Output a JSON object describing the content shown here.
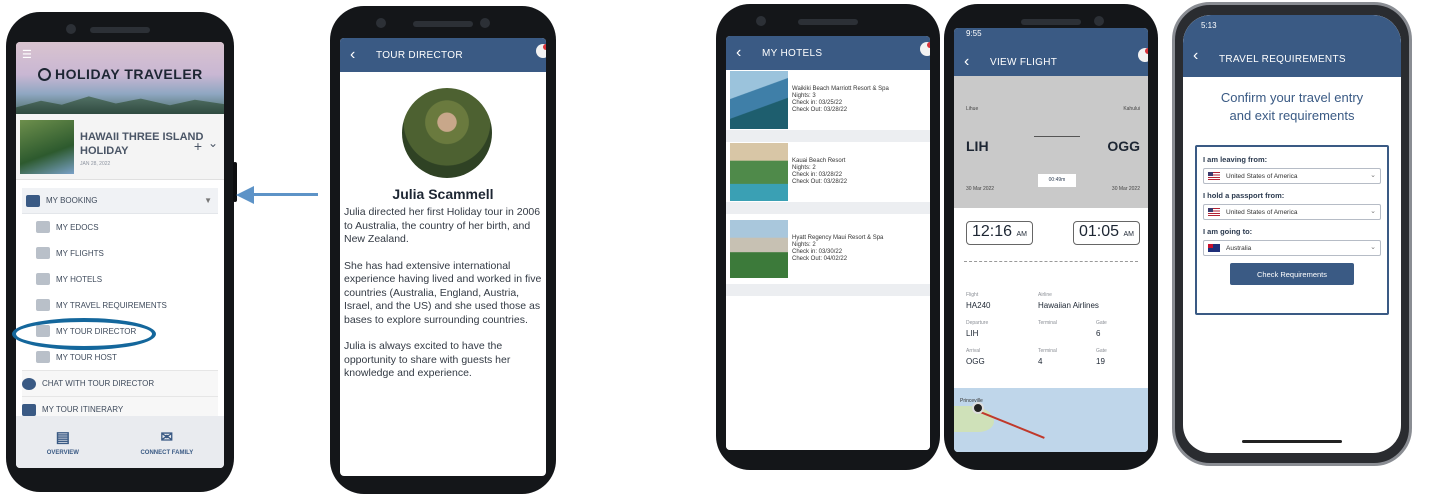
{
  "colors": {
    "navy": "#3a5a84",
    "ring": "#14679c",
    "arrow": "#5d93c7"
  },
  "phone1": {
    "brand": "HOLIDAY TRAVELER",
    "trip_title": "HAWAII THREE ISLAND HOLIDAY",
    "trip_date": "JAN 28, 2022",
    "menu": [
      {
        "label": "MY BOOKING",
        "icon": "booking-icon"
      },
      {
        "label": "MY EDOCS",
        "icon": "edocs-icon"
      },
      {
        "label": "MY FLIGHTS",
        "icon": "plane-icon"
      },
      {
        "label": "MY HOTELS",
        "icon": "hotel-icon"
      },
      {
        "label": "MY TRAVEL REQUIREMENTS",
        "icon": "requirements-icon"
      },
      {
        "label": "MY TOUR DIRECTOR",
        "icon": "person-icon"
      },
      {
        "label": "MY TOUR HOST",
        "icon": "person-icon"
      },
      {
        "label": "CHAT WITH TOUR DIRECTOR",
        "icon": "chat-icon"
      },
      {
        "label": "MY TOUR ITINERARY",
        "icon": "itinerary-icon"
      }
    ],
    "tabs": [
      {
        "label": "OVERVIEW",
        "icon": "document-icon"
      },
      {
        "label": "CONNECT FAMILY",
        "icon": "envelope-icon"
      }
    ]
  },
  "phone2": {
    "title": "TOUR DIRECTOR",
    "name": "Julia Scammell",
    "bio": [
      "Julia directed her first Holiday tour in 2006 to Australia, the country of her birth, and New Zealand.",
      "She has had extensive international experience having lived and worked in five countries (Australia, England, Austria, Israel, and the US) and she used those as bases to explore surrounding countries.",
      "Julia is always excited to have the opportunity to share with guests her knowledge and experience."
    ]
  },
  "phone3": {
    "title": "MY HOTELS",
    "hotels": [
      {
        "name": "Waikiki Beach Marriott Resort & Spa",
        "nights": "Nights: 3",
        "checkin": "Check in: 03/25/22",
        "checkout": "Check Out: 03/28/22"
      },
      {
        "name": "Kauai Beach Resort",
        "nights": "Nights: 2",
        "checkin": "Check in: 03/28/22",
        "checkout": "Check Out: 03/28/22"
      },
      {
        "name": "Hyatt Regency Maui Resort & Spa",
        "nights": "Nights: 2",
        "checkin": "Check in: 03/30/22",
        "checkout": "Check Out: 04/02/22"
      }
    ]
  },
  "phone4": {
    "clock": "9:55",
    "title": "VIEW FLIGHT",
    "from_city": "Lihue",
    "to_city": "Kahului",
    "from_code": "LIH",
    "to_code": "OGG",
    "from_date": "30 Mar 2022",
    "to_date": "30 Mar 2022",
    "duration": "00:49m",
    "depart_time": "12:16",
    "depart_ampm": "AM",
    "arrive_time": "01:05",
    "arrive_ampm": "AM",
    "labels": {
      "flight": "Flight",
      "airline": "Airline",
      "departure": "Departure",
      "terminal": "Terminal",
      "gate": "Gate",
      "arrival": "Arrival"
    },
    "flight": "HA240",
    "airline": "Hawaiian Airlines",
    "departure": "LIH",
    "dep_terminal": "2",
    "dep_gate": "6",
    "arrival": "OGG",
    "arr_terminal": "4",
    "arr_gate": "19",
    "map_label": "Princeville"
  },
  "phone5": {
    "clock": "5:13",
    "title": "TRAVEL REQUIREMENTS",
    "heading_line1": "Confirm your travel entry",
    "heading_line2": "and exit requirements",
    "leaving_label": "I am leaving from:",
    "leaving_value": "United States of America",
    "passport_label": "I hold a passport from:",
    "passport_value": "United States of America",
    "going_label": "I am going to:",
    "going_value": "Australia",
    "button": "Check Requirements"
  }
}
